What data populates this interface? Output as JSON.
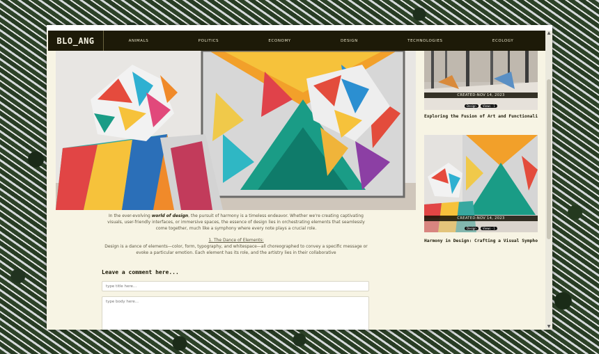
{
  "brand": {
    "logo": "BLO_ANG"
  },
  "nav": {
    "items": [
      "ANIMALS",
      "POLITICS",
      "ECONOMY",
      "DESIGN",
      "TECHNOLOGIES",
      "ECOLOGY"
    ]
  },
  "article": {
    "intro_before": "In the ever-evolving ",
    "intro_em": "world of design",
    "intro_after": ", the pursuit of harmony is a timeless endeavor. Whether we're creating captivating visuals, user-friendly interfaces, or immersive spaces, the essence of design lies in orchestrating elements that seamlessly come together, much like a symphony where every note plays a crucial role.",
    "section_title": "1. The Dance of Elements:",
    "section_text": "Design is a dance of elements—color, form, typography, and whitespace—all choreographed to convey a specific message or evoke a particular emotion. Each element has its role, and the artistry lies in their collaborative"
  },
  "comment": {
    "heading": "Leave a comment here...",
    "title_placeholder": "type title here...",
    "body_placeholder": "type body here..."
  },
  "sidebar": {
    "cards": [
      {
        "created": "CREATED-NOV 14, 2023",
        "category": "Design",
        "views": "Views - 1",
        "title": "Exploring the Fusion of Art and Functionality: A Desi..."
      },
      {
        "created": "CREATED-NOV 14, 2023",
        "category": "Design",
        "views": "Views - 1",
        "title": "Harmony in Design: Crafting a Visual Symphony"
      }
    ]
  },
  "icons": {
    "scroll_up": "chevron-up-icon",
    "scroll_down": "chevron-down-icon"
  }
}
